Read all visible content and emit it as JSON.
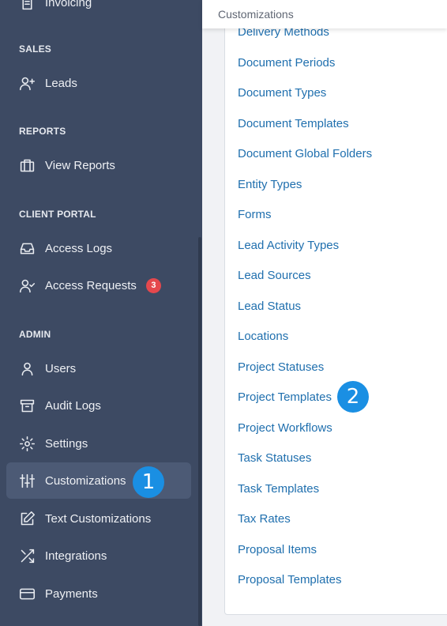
{
  "sidebar": {
    "sections": {
      "sales": "SALES",
      "reports": "REPORTS",
      "client_portal": "CLIENT PORTAL",
      "admin": "ADMIN"
    },
    "items": {
      "invoicing": "Invoicing",
      "leads": "Leads",
      "view_reports": "View Reports",
      "access_logs": "Access Logs",
      "access_requests": "Access Requests",
      "users": "Users",
      "audit_logs": "Audit Logs",
      "settings": "Settings",
      "customizations": "Customizations",
      "text_customizations": "Text Customizations",
      "integrations": "Integrations",
      "payments": "Payments"
    },
    "access_requests_badge": "3",
    "active_item": "customizations"
  },
  "header": {
    "title": "Customizations"
  },
  "customizations": [
    "Delivery Methods",
    "Document Periods",
    "Document Types",
    "Document Templates",
    "Document Global Folders",
    "Entity Types",
    "Forms",
    "Lead Activity Types",
    "Lead Sources",
    "Lead Status",
    "Locations",
    "Project Statuses",
    "Project Templates",
    "Project Workflows",
    "Task Statuses",
    "Task Templates",
    "Tax Rates",
    "Proposal Items",
    "Proposal Templates"
  ],
  "markers": {
    "step1": "1",
    "step2": "2"
  },
  "colors": {
    "sidebar_bg": "#3d4a63",
    "active_item_bg": "#4c5a75",
    "link": "#1f6fae",
    "marker": "#1a8fe3",
    "badge": "#e5484d"
  },
  "icons": {
    "invoicing": "document-icon",
    "leads": "user-plus-icon",
    "view_reports": "briefcase-icon",
    "access_logs": "inbox-icon",
    "access_requests": "user-check-icon",
    "users": "user-icon",
    "audit_logs": "archive-icon",
    "settings": "gear-icon",
    "customizations": "sliders-icon",
    "text_customizations": "edit-icon",
    "integrations": "shuffle-icon",
    "payments": "credit-card-icon"
  }
}
